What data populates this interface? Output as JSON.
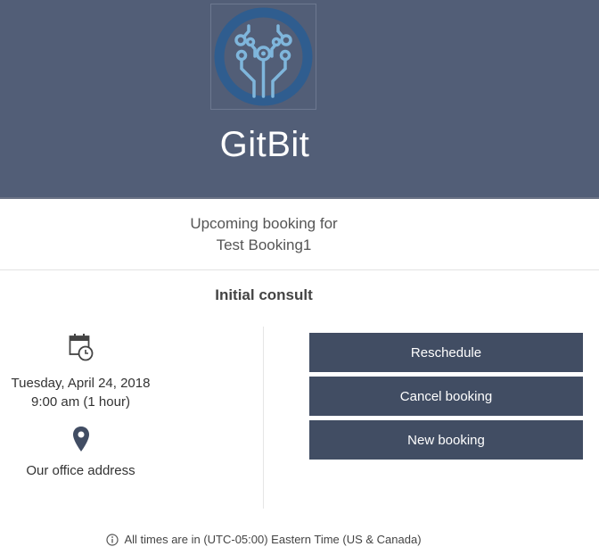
{
  "header": {
    "brand_name": "GitBit",
    "logo_icon": "circuit-logo-icon",
    "background_color": "#525e77"
  },
  "booking": {
    "heading_line1": "Upcoming booking for",
    "heading_line2": "Test Booking1",
    "service_name": "Initial consult",
    "date": "Tuesday, April 24, 2018",
    "time": "9:00 am (1 hour)",
    "location": "Our office address",
    "calendar_icon": "calendar-clock-icon",
    "location_icon": "map-pin-icon"
  },
  "actions": {
    "reschedule": "Reschedule",
    "cancel": "Cancel booking",
    "new": "New booking",
    "button_color": "#414d63"
  },
  "footer": {
    "timezone_note": "All times are in (UTC-05:00) Eastern Time (US & Canada)",
    "info_icon": "info-icon"
  }
}
